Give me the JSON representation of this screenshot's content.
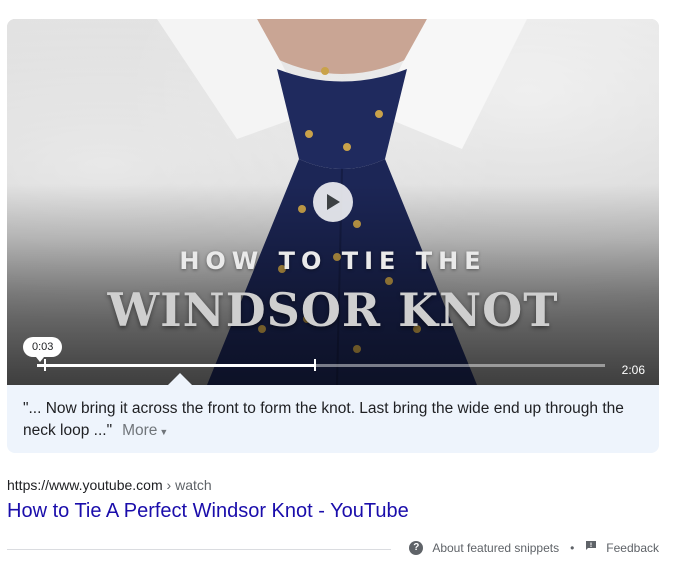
{
  "video": {
    "title_line1": "HOW TO TIE THE",
    "title_line2": "WINDSOR KNOT",
    "current_time": "0:03",
    "duration": "2:06",
    "progress": 0.49,
    "snippet_start": 0.0125,
    "play_icon": "play-icon"
  },
  "snippet": {
    "text": "\"... Now bring it across the front to form the knot. Last bring the wide end up through the neck loop ...\"",
    "more_label": "More",
    "more_icon": "chevron-down-icon"
  },
  "result": {
    "url_domain": "https://www.youtube.com",
    "url_path": " › watch",
    "title": "How to Tie A Perfect Windsor Knot - YouTube"
  },
  "footer": {
    "about_label": "About featured snippets",
    "separator": "•",
    "feedback_label": "Feedback",
    "about_icon": "help-circle-icon",
    "feedback_icon": "feedback-icon"
  },
  "colors": {
    "snippet_bg": "#eef4fc",
    "link": "#1a0dab",
    "tie": "#1f2a5e"
  }
}
